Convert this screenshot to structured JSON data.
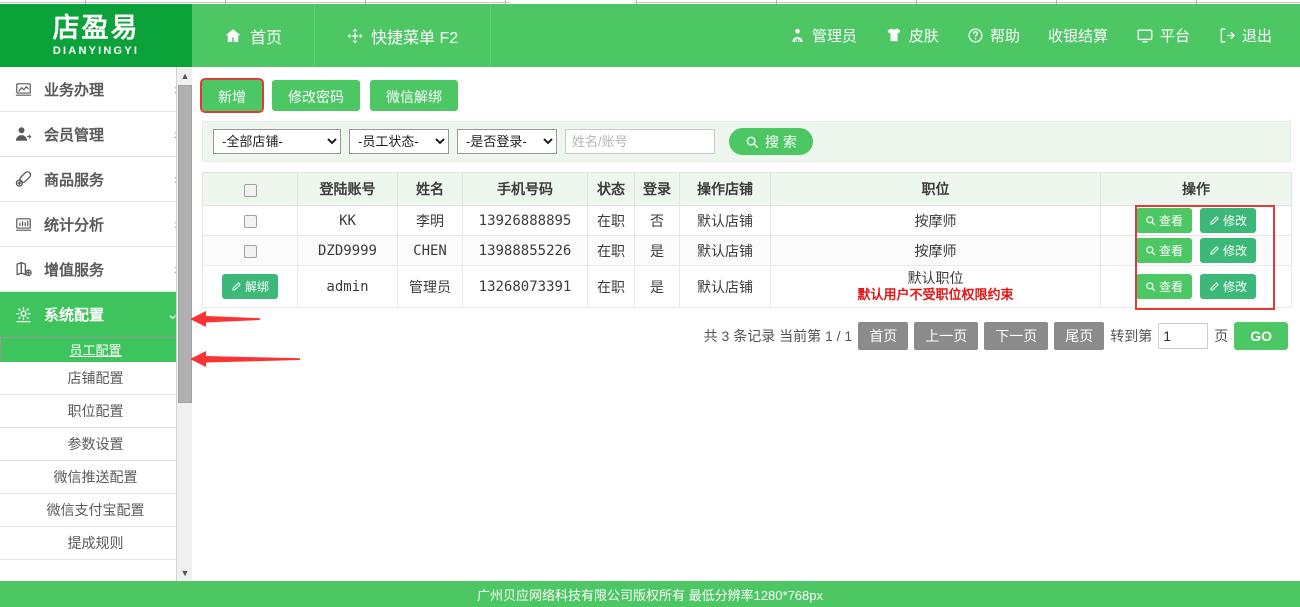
{
  "brand": {
    "logo_cn": "店盈易",
    "logo_en": "DIANYINGYI",
    "header_green": "#4cc764",
    "logo_green": "#0ba239",
    "accent_red": "#e03a3a"
  },
  "header": {
    "tabs": [
      {
        "label": "首页",
        "icon": "home-icon"
      },
      {
        "label": "快捷菜单 F2",
        "icon": "move-arrows-icon"
      }
    ],
    "right_items": [
      {
        "label": "管理员",
        "icon": "user-admin-icon"
      },
      {
        "label": "皮肤",
        "icon": "tshirt-icon"
      },
      {
        "label": "帮助",
        "icon": "question-circle-icon"
      },
      {
        "label": "收银结算",
        "icon": ""
      },
      {
        "label": "平台",
        "icon": "monitor-icon"
      },
      {
        "label": "退出",
        "icon": "logout-icon"
      }
    ]
  },
  "sidebar": {
    "items": [
      {
        "label": "业务办理",
        "icon": "chart-image-icon",
        "chevron": "›",
        "active": false
      },
      {
        "label": "会员管理",
        "icon": "member-icon",
        "chevron": "›",
        "active": false
      },
      {
        "label": "商品服务",
        "icon": "goods-icon",
        "chevron": "›",
        "active": false
      },
      {
        "label": "统计分析",
        "icon": "statistics-icon",
        "chevron": "›",
        "active": false
      },
      {
        "label": "增值服务",
        "icon": "value-added-icon",
        "chevron": "›",
        "active": false
      },
      {
        "label": "系统配置",
        "icon": "gear-icon",
        "chevron": "⌄",
        "active": true
      }
    ],
    "sub_items": [
      {
        "label": "员工配置",
        "selected": true
      },
      {
        "label": "店铺配置",
        "selected": false
      },
      {
        "label": "职位配置",
        "selected": false
      },
      {
        "label": "参数设置",
        "selected": false
      },
      {
        "label": "微信推送配置",
        "selected": false
      },
      {
        "label": "微信支付宝配置",
        "selected": false
      },
      {
        "label": "提成规则",
        "selected": false
      }
    ]
  },
  "toolbar": {
    "add_label": "新增",
    "change_password_label": "修改密码",
    "wechat_unbind_label": "微信解绑"
  },
  "filters": {
    "store_select": "-全部店铺-",
    "status_select": "-员工状态-",
    "login_select": "-是否登录-",
    "keyword_value": "",
    "keyword_placeholder": "姓名/账号",
    "search_label": "搜 索",
    "search_icon": "search-icon"
  },
  "table": {
    "headers": [
      "",
      "登陆账号",
      "姓名",
      "手机号码",
      "状态",
      "登录",
      "操作店铺",
      "职位",
      "操作"
    ],
    "rows": [
      {
        "select_type": "checkbox",
        "select_label": "",
        "account": "KK",
        "name": "李明",
        "phone": "13926888895",
        "status": "在职",
        "logged": "否",
        "store": "默认店铺",
        "position": "按摩师",
        "position_note": "",
        "view_label": "查看",
        "edit_label": "修改"
      },
      {
        "select_type": "checkbox",
        "select_label": "",
        "account": "DZD9999",
        "name": "CHEN",
        "phone": "13988855226",
        "status": "在职",
        "logged": "是",
        "store": "默认店铺",
        "position": "按摩师",
        "position_note": "",
        "view_label": "查看",
        "edit_label": "修改"
      },
      {
        "select_type": "button",
        "select_label": "解绑",
        "account": "admin",
        "name": "管理员",
        "phone": "13268073391",
        "status": "在职",
        "logged": "是",
        "store": "默认店铺",
        "position": "默认职位",
        "position_note": "默认用户不受职位权限约束",
        "view_label": "查看",
        "edit_label": "修改"
      }
    ]
  },
  "pagination": {
    "summary": "共 3 条记录 当前第 1 / 1",
    "first": "首页",
    "prev": "上一页",
    "next": "下一页",
    "last": "尾页",
    "jump_prefix": "转到第",
    "page_value": "1",
    "jump_suffix": "页",
    "go_label": "GO"
  },
  "footer": {
    "text": "广州贝应网络科技有限公司版权所有 最低分辨率1280*768px"
  }
}
